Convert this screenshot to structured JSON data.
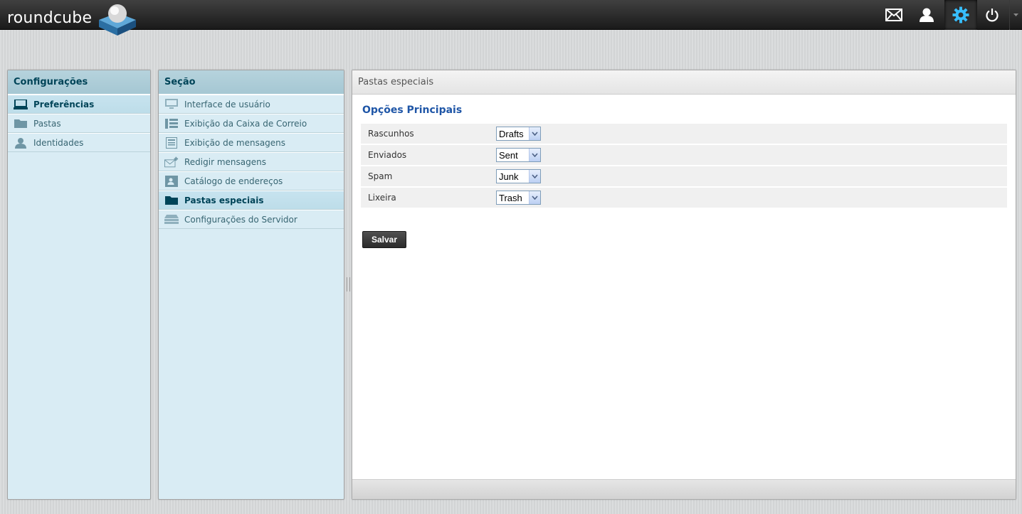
{
  "app": {
    "logo_text": "roundcube"
  },
  "topbar": {
    "buttons": [
      {
        "icon": "mail-icon",
        "active": false
      },
      {
        "icon": "contacts-icon",
        "active": false
      },
      {
        "icon": "settings-gear-icon",
        "active": true
      },
      {
        "icon": "logout-power-icon",
        "active": false
      }
    ],
    "accent": "#37beff"
  },
  "settings_panel": {
    "title": "Configurações",
    "items": [
      {
        "label": "Preferências",
        "icon": "laptop-icon",
        "selected": true
      },
      {
        "label": "Pastas",
        "icon": "folder-icon",
        "selected": false
      },
      {
        "label": "Identidades",
        "icon": "person-icon",
        "selected": false
      }
    ]
  },
  "section_panel": {
    "title": "Seção",
    "items": [
      {
        "label": "Interface de usuário",
        "icon": "monitor-icon",
        "selected": false
      },
      {
        "label": "Exibição da Caixa de Correio",
        "icon": "mailbox-layout-icon",
        "selected": false
      },
      {
        "label": "Exibição de mensagens",
        "icon": "message-view-icon",
        "selected": false
      },
      {
        "label": "Redigir mensagens",
        "icon": "compose-icon",
        "selected": false
      },
      {
        "label": "Catálogo de endereços",
        "icon": "addressbook-icon",
        "selected": false
      },
      {
        "label": "Pastas especiais",
        "icon": "folder-icon",
        "selected": true
      },
      {
        "label": "Configurações do Servidor",
        "icon": "server-icon",
        "selected": false
      }
    ]
  },
  "content": {
    "header": "Pastas especiais",
    "section_title": "Opções Principais",
    "options": [
      {
        "label": "Rascunhos",
        "value": "Drafts"
      },
      {
        "label": "Enviados",
        "value": "Sent"
      },
      {
        "label": "Spam",
        "value": "Junk"
      },
      {
        "label": "Lixeira",
        "value": "Trash"
      }
    ],
    "save_label": "Salvar"
  }
}
